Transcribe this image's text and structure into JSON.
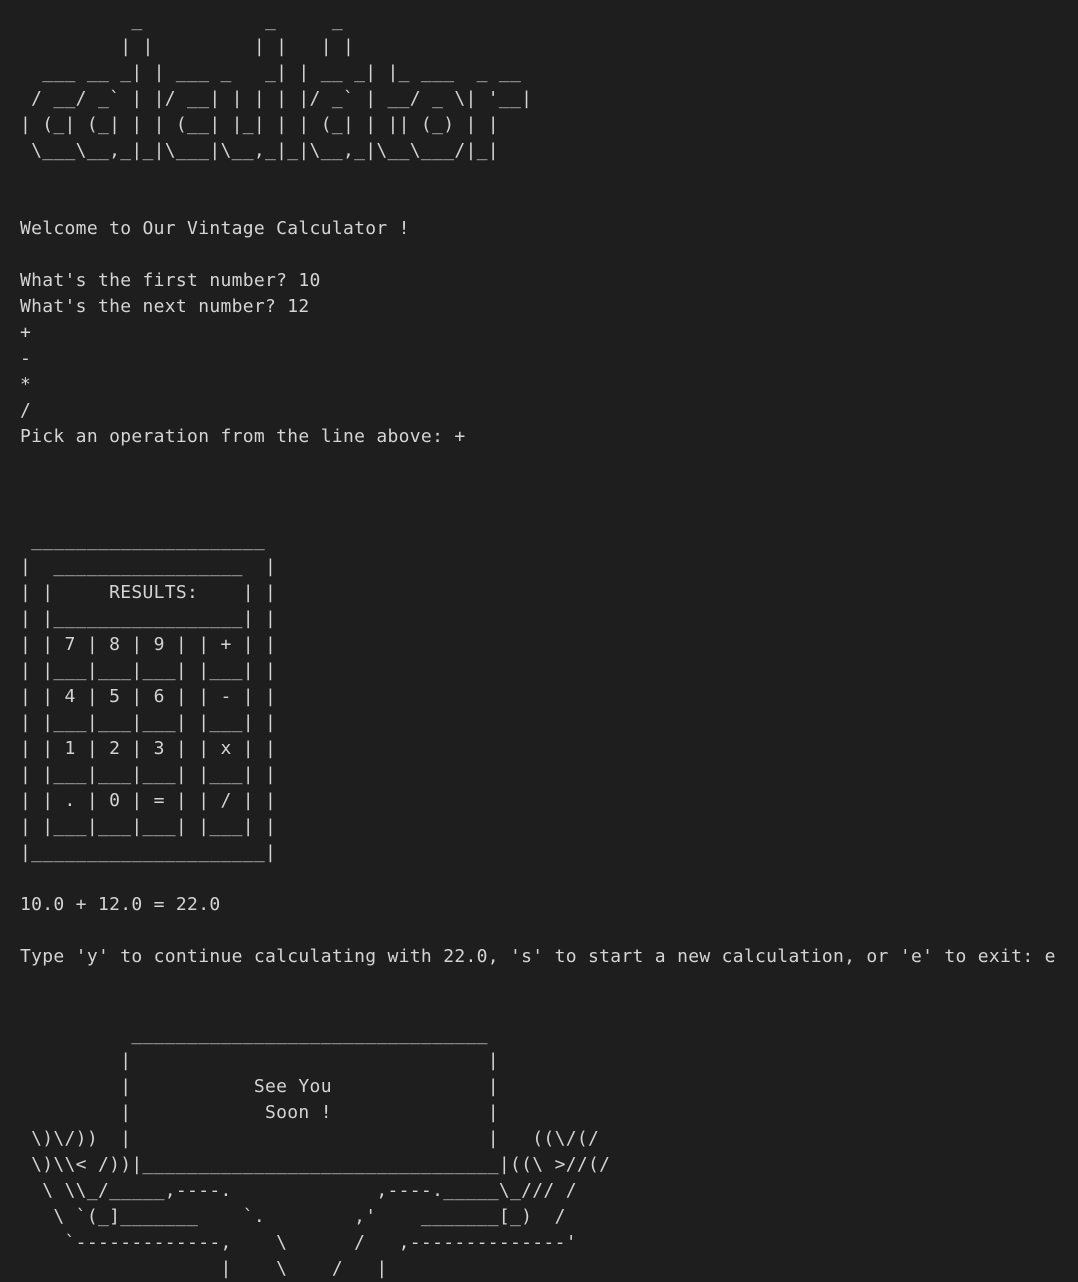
{
  "logo_ascii": "          _           _     _\n         | |         | |   | |\n  ___ __ _| | ___ _   _| | __ _| |_ ___  _ __\n / __/ _` | |/ __| | | | |/ _` | __/ _ \\| '__|\n| (_| (_| | | (__| |_| | | (_| | || (_) | |\n \\___\\__,_|_|\\___|\\__,_|_|\\__,_|\\__\\___/|_|",
  "welcome": "Welcome to Our Vintage Calculator !",
  "prompt_first": "What's the first number? 10",
  "prompt_next": "What's the next number? 12",
  "operations": [
    "+",
    "-",
    "*",
    "/"
  ],
  "prompt_operation": "Pick an operation from the line above: +",
  "calculator_ascii": " _____________________\n|  _________________  |\n| |     RESULTS:    | |\n| |_________________| |\n| | 7 | 8 | 9 | | + | |\n| |___|___|___| |___| |\n| | 4 | 5 | 6 | | - | |\n| |___|___|___| |___| |\n| | 1 | 2 | 3 | | x | |\n| |___|___|___| |___| |\n| | . | 0 | = | | / | |\n| |___|___|___| |___| |\n|_____________________|",
  "result_line": "10.0 + 12.0 = 22.0",
  "continue_prompt": "Type 'y' to continue calculating with 22.0, 's' to start a new calculation, or 'e' to exit: e",
  "goodbye_ascii": "          ________________________________\n         |                                |\n         |           See You              |\n         |            Soon !              |\n \\)\\/))  |                                |   ((\\/(/\n \\)\\\\< /))|________________________________|((\\ >//(/\n  \\ \\\\_/_____,----.             ,----._____\\_/// /\n   \\ `(_]_______    `.        ,'    _______[_)  /\n    `-------------,    \\      /   ,--------------'\n                  |    \\    /   |"
}
